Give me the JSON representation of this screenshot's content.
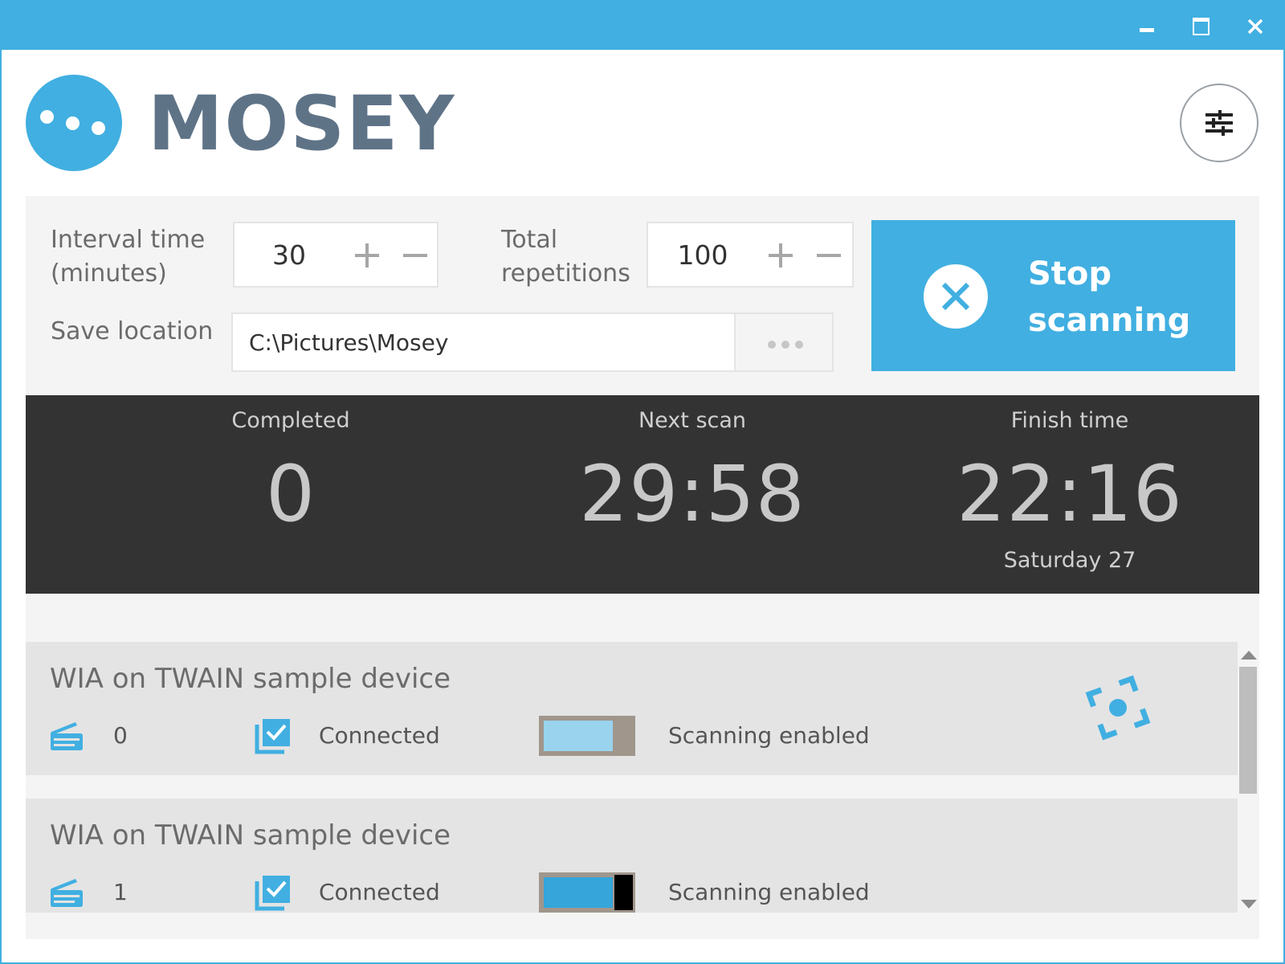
{
  "app": {
    "title": "MOSEY"
  },
  "window_controls": {
    "icons": [
      "minimize-icon",
      "maximize-icon",
      "close-icon"
    ]
  },
  "settings": {
    "icon": "sliders-icon"
  },
  "controls": {
    "interval_label": "Interval time (minutes)",
    "interval_value": "30",
    "repetitions_label": "Total repetitions",
    "repetitions_value": "100",
    "save_location_label": "Save location",
    "save_location_value": "C:\\Pictures\\Mosey",
    "browse_icon": "ellipsis-icon"
  },
  "stop_button": {
    "label": "Stop scanning",
    "icon": "close-circle-icon"
  },
  "stats": {
    "completed_label": "Completed",
    "completed_value": "0",
    "next_scan_label": "Next scan",
    "next_scan_value": "29:58",
    "finish_time_label": "Finish time",
    "finish_time_value": "22:16",
    "finish_day": "Saturday 27"
  },
  "devices": [
    {
      "name": "WIA on TWAIN sample device",
      "count": "0",
      "status": "Connected",
      "scanning_label": "Scanning enabled",
      "toggle_on": true,
      "toggle_fill_color": "#99d3ee",
      "toggle_knob_color": "#a0968c"
    },
    {
      "name": "WIA on TWAIN sample device",
      "count": "1",
      "status": "Connected",
      "scanning_label": "Scanning enabled",
      "toggle_on": true,
      "toggle_fill_color": "#35a5da",
      "toggle_knob_color": "#000000"
    }
  ],
  "colors": {
    "accent": "#41afe1",
    "title_text": "#5f7387",
    "stats_bg": "#333333"
  }
}
